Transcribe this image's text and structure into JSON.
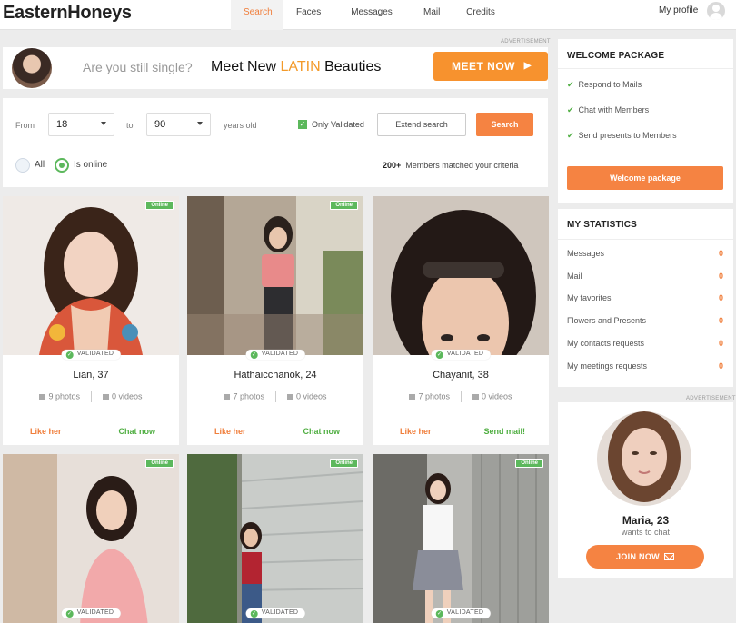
{
  "brand": {
    "logo": "EasternHoneys"
  },
  "nav": {
    "items": [
      {
        "label": "Search",
        "active": true
      },
      {
        "label": "Faces",
        "active": false
      },
      {
        "label": "Messages",
        "active": false
      },
      {
        "label": "Mail",
        "active": false
      },
      {
        "label": "Credits",
        "active": false
      }
    ],
    "profile_label": "My profile"
  },
  "ads": {
    "label": "ADVERTISEMENT"
  },
  "banner": {
    "question": "Are you still single?",
    "meet_prefix": "Meet New ",
    "meet_highlight": "LATIN",
    "meet_suffix": " Beauties",
    "cta": "MEET NOW"
  },
  "filter": {
    "from_label": "From",
    "from_value": "18",
    "to_label": "to",
    "to_value": "90",
    "years_label": "years old",
    "only_validated_label": "Only Validated",
    "only_validated_checked": true,
    "extend_label": "Extend search",
    "search_label": "Search",
    "radio_all": "All",
    "radio_online": "Is online",
    "selected_radio": "Is online",
    "matched_count": "200+",
    "matched_text": "Members matched your criteria"
  },
  "badges": {
    "online": "Online",
    "validated": "VALIDATED"
  },
  "profiles": [
    {
      "name": "Lian, 37",
      "photos": "9 photos",
      "videos": "0 videos",
      "like": "Like her",
      "action": "Chat now"
    },
    {
      "name": "Hathaicchanok, 24",
      "photos": "7 photos",
      "videos": "0 videos",
      "like": "Like her",
      "action": "Chat now"
    },
    {
      "name": "Chayanit, 38",
      "photos": "7 photos",
      "videos": "0 videos",
      "like": "Like her",
      "action": "Send mail!"
    }
  ],
  "sidebar": {
    "welcome": {
      "title": "WELCOME PACKAGE",
      "items": [
        "Respond to Mails",
        "Chat with Members",
        "Send presents to Members"
      ],
      "button": "Welcome package"
    },
    "stats": {
      "title": "MY STATISTICS",
      "rows": [
        {
          "label": "Messages",
          "value": "0"
        },
        {
          "label": "Mail",
          "value": "0"
        },
        {
          "label": "My favorites",
          "value": "0"
        },
        {
          "label": "Flowers and Presents",
          "value": "0"
        },
        {
          "label": "My contacts requests",
          "value": "0"
        },
        {
          "label": "My meetings requests",
          "value": "0"
        }
      ]
    },
    "chat_ad": {
      "name": "Maria, 23",
      "subtitle": "wants to chat",
      "cta": "JOIN NOW"
    }
  },
  "colors": {
    "accent": "#f58342",
    "green": "#5cb85c",
    "nav_active": "#f07e3b"
  }
}
